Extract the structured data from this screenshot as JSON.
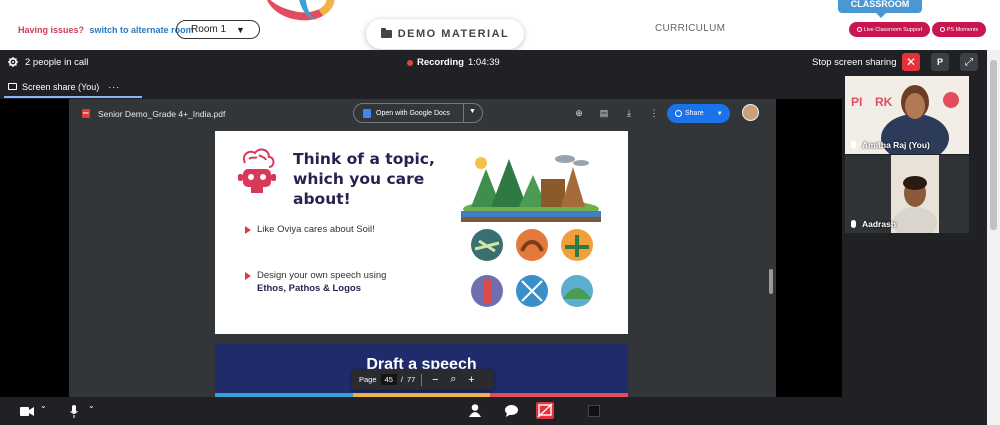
{
  "topbar": {
    "issues_text": "Having issues?",
    "alt_room_link": "switch to alternate room",
    "room_select_value": "Room 1",
    "demo_material_label": "DEMO MATERIAL",
    "curriculum_label": "CURRICULUM",
    "classroom_label": "CLASSROOM",
    "support_label": "Live Classroom Support",
    "moments_label": "PS Moments"
  },
  "call": {
    "people_count": "2 people in call",
    "recording_label": "Recording",
    "recording_time": "1:04:39",
    "stop_sharing_label": "Stop screen sharing",
    "p_button_label": "P",
    "share_tab_label": "Screen share (You)"
  },
  "pdf": {
    "file_name": "Senior Demo_Grade 4+_India.pdf",
    "open_with_label": "Open with Google Docs",
    "share_label": "Share",
    "page_label": "Page",
    "page_current": "45",
    "page_separator": "/",
    "page_total": "77"
  },
  "slide": {
    "title": "Think of a topic, which you care about!",
    "bullet1": "Like Oviya cares about Soil!",
    "bullet2_prefix": "Design your own speech using",
    "bullet2_bold": "Ethos, Pathos & Logos",
    "next_slide_title": "Draft a speech"
  },
  "participants": [
    {
      "name": "Amitha Raj (You)"
    },
    {
      "name": "Aadrash"
    }
  ],
  "colors": {
    "accent_red": "#e3323a",
    "share_blue": "#1a73e8",
    "brand_pink": "#c8174f",
    "classroom_blue": "#4b97d1"
  }
}
